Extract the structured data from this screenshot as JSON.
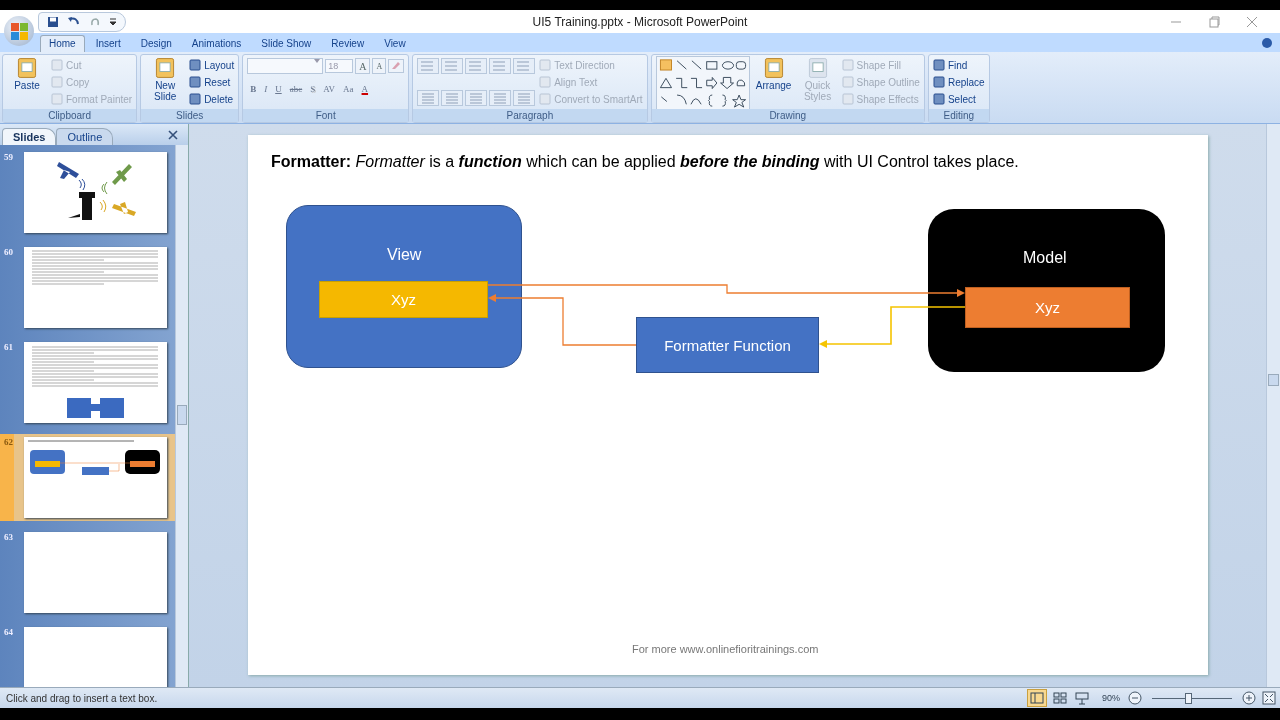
{
  "window": {
    "title": "UI5 Training.pptx - Microsoft PowerPoint"
  },
  "tabs": [
    {
      "label": "Home",
      "selected": true
    },
    {
      "label": "Insert",
      "selected": false
    },
    {
      "label": "Design",
      "selected": false
    },
    {
      "label": "Animations",
      "selected": false
    },
    {
      "label": "Slide Show",
      "selected": false
    },
    {
      "label": "Review",
      "selected": false
    },
    {
      "label": "View",
      "selected": false
    }
  ],
  "ribbon": [
    {
      "kind": "plain",
      "label": "Clipboard",
      "buttons": [
        {
          "label": "Paste",
          "kind": "large",
          "disabled": false
        },
        {
          "label": "Cut",
          "kind": "small",
          "disabled": true
        },
        {
          "label": "Copy",
          "kind": "small",
          "disabled": true
        },
        {
          "label": "Format Painter",
          "kind": "small",
          "disabled": true
        }
      ]
    },
    {
      "kind": "plain",
      "label": "Slides",
      "buttons": [
        {
          "label": "New Slide",
          "kind": "large",
          "disabled": false
        },
        {
          "label": "Layout",
          "kind": "small",
          "disabled": false
        },
        {
          "label": "Reset",
          "kind": "small",
          "disabled": false
        },
        {
          "label": "Delete",
          "kind": "small",
          "disabled": false
        }
      ]
    },
    {
      "kind": "font",
      "label": "Font",
      "font_size": "18",
      "size_buttons": [
        "A",
        "A"
      ],
      "format_buttons": [
        "B",
        "I",
        "U",
        "abc",
        "S",
        "AV",
        "Aa",
        "A"
      ]
    },
    {
      "kind": "paragraph",
      "label": "Paragraph",
      "buttons": [
        {
          "label": "Text Direction",
          "kind": "small",
          "disabled": true
        },
        {
          "label": "Align Text",
          "kind": "small",
          "disabled": true
        },
        {
          "label": "Convert to SmartArt",
          "kind": "small",
          "disabled": true
        }
      ]
    },
    {
      "kind": "drawing",
      "label": "Drawing",
      "buttons": [
        {
          "label": "Arrange",
          "kind": "large",
          "disabled": false
        },
        {
          "label": "Quick Styles",
          "kind": "large",
          "disabled": true
        },
        {
          "label": "Shape Fill",
          "kind": "small",
          "disabled": true
        },
        {
          "label": "Shape Outline",
          "kind": "small",
          "disabled": true
        },
        {
          "label": "Shape Effects",
          "kind": "small",
          "disabled": true
        }
      ]
    },
    {
      "kind": "plain",
      "label": "Editing",
      "buttons": [
        {
          "label": "Find",
          "kind": "small",
          "disabled": false
        },
        {
          "label": "Replace",
          "kind": "small",
          "disabled": false
        },
        {
          "label": "Select",
          "kind": "small",
          "disabled": false
        }
      ]
    }
  ],
  "panel_tabs": [
    {
      "label": "Slides",
      "selected": true
    },
    {
      "label": "Outline",
      "selected": false
    }
  ],
  "thumbnails": [
    {
      "number": "59",
      "kind": "icons",
      "selected": false
    },
    {
      "number": "60",
      "kind": "text",
      "selected": false
    },
    {
      "number": "61",
      "kind": "text-figure",
      "selected": false
    },
    {
      "number": "62",
      "kind": "diagram",
      "selected": true
    },
    {
      "number": "63",
      "kind": "blank",
      "selected": false
    },
    {
      "number": "64",
      "kind": "blank",
      "selected": false
    }
  ],
  "slide": {
    "heading": [
      {
        "text": "Formatter: ",
        "kind": "label"
      },
      {
        "text": "Formatter",
        "kind": "term"
      },
      {
        "text": " is a ",
        "kind": "plain"
      },
      {
        "text": "function",
        "kind": "emphasis"
      },
      {
        "text": " which can be applied ",
        "kind": "plain"
      },
      {
        "text": "before the binding",
        "kind": "emphasis"
      },
      {
        "text": " with UI Control takes place.",
        "kind": "plain"
      }
    ],
    "view": {
      "label": "View",
      "field": "Xyz"
    },
    "model": {
      "label": "Model",
      "field": "Xyz"
    },
    "formatter": "Formatter Function",
    "footer": "For more www.onlinefioritrainings.com"
  },
  "status_bar": {
    "message": "Click and drag to insert a text box.",
    "zoom": "90%",
    "zoom_slider": {
      "level": 0.45
    }
  }
}
